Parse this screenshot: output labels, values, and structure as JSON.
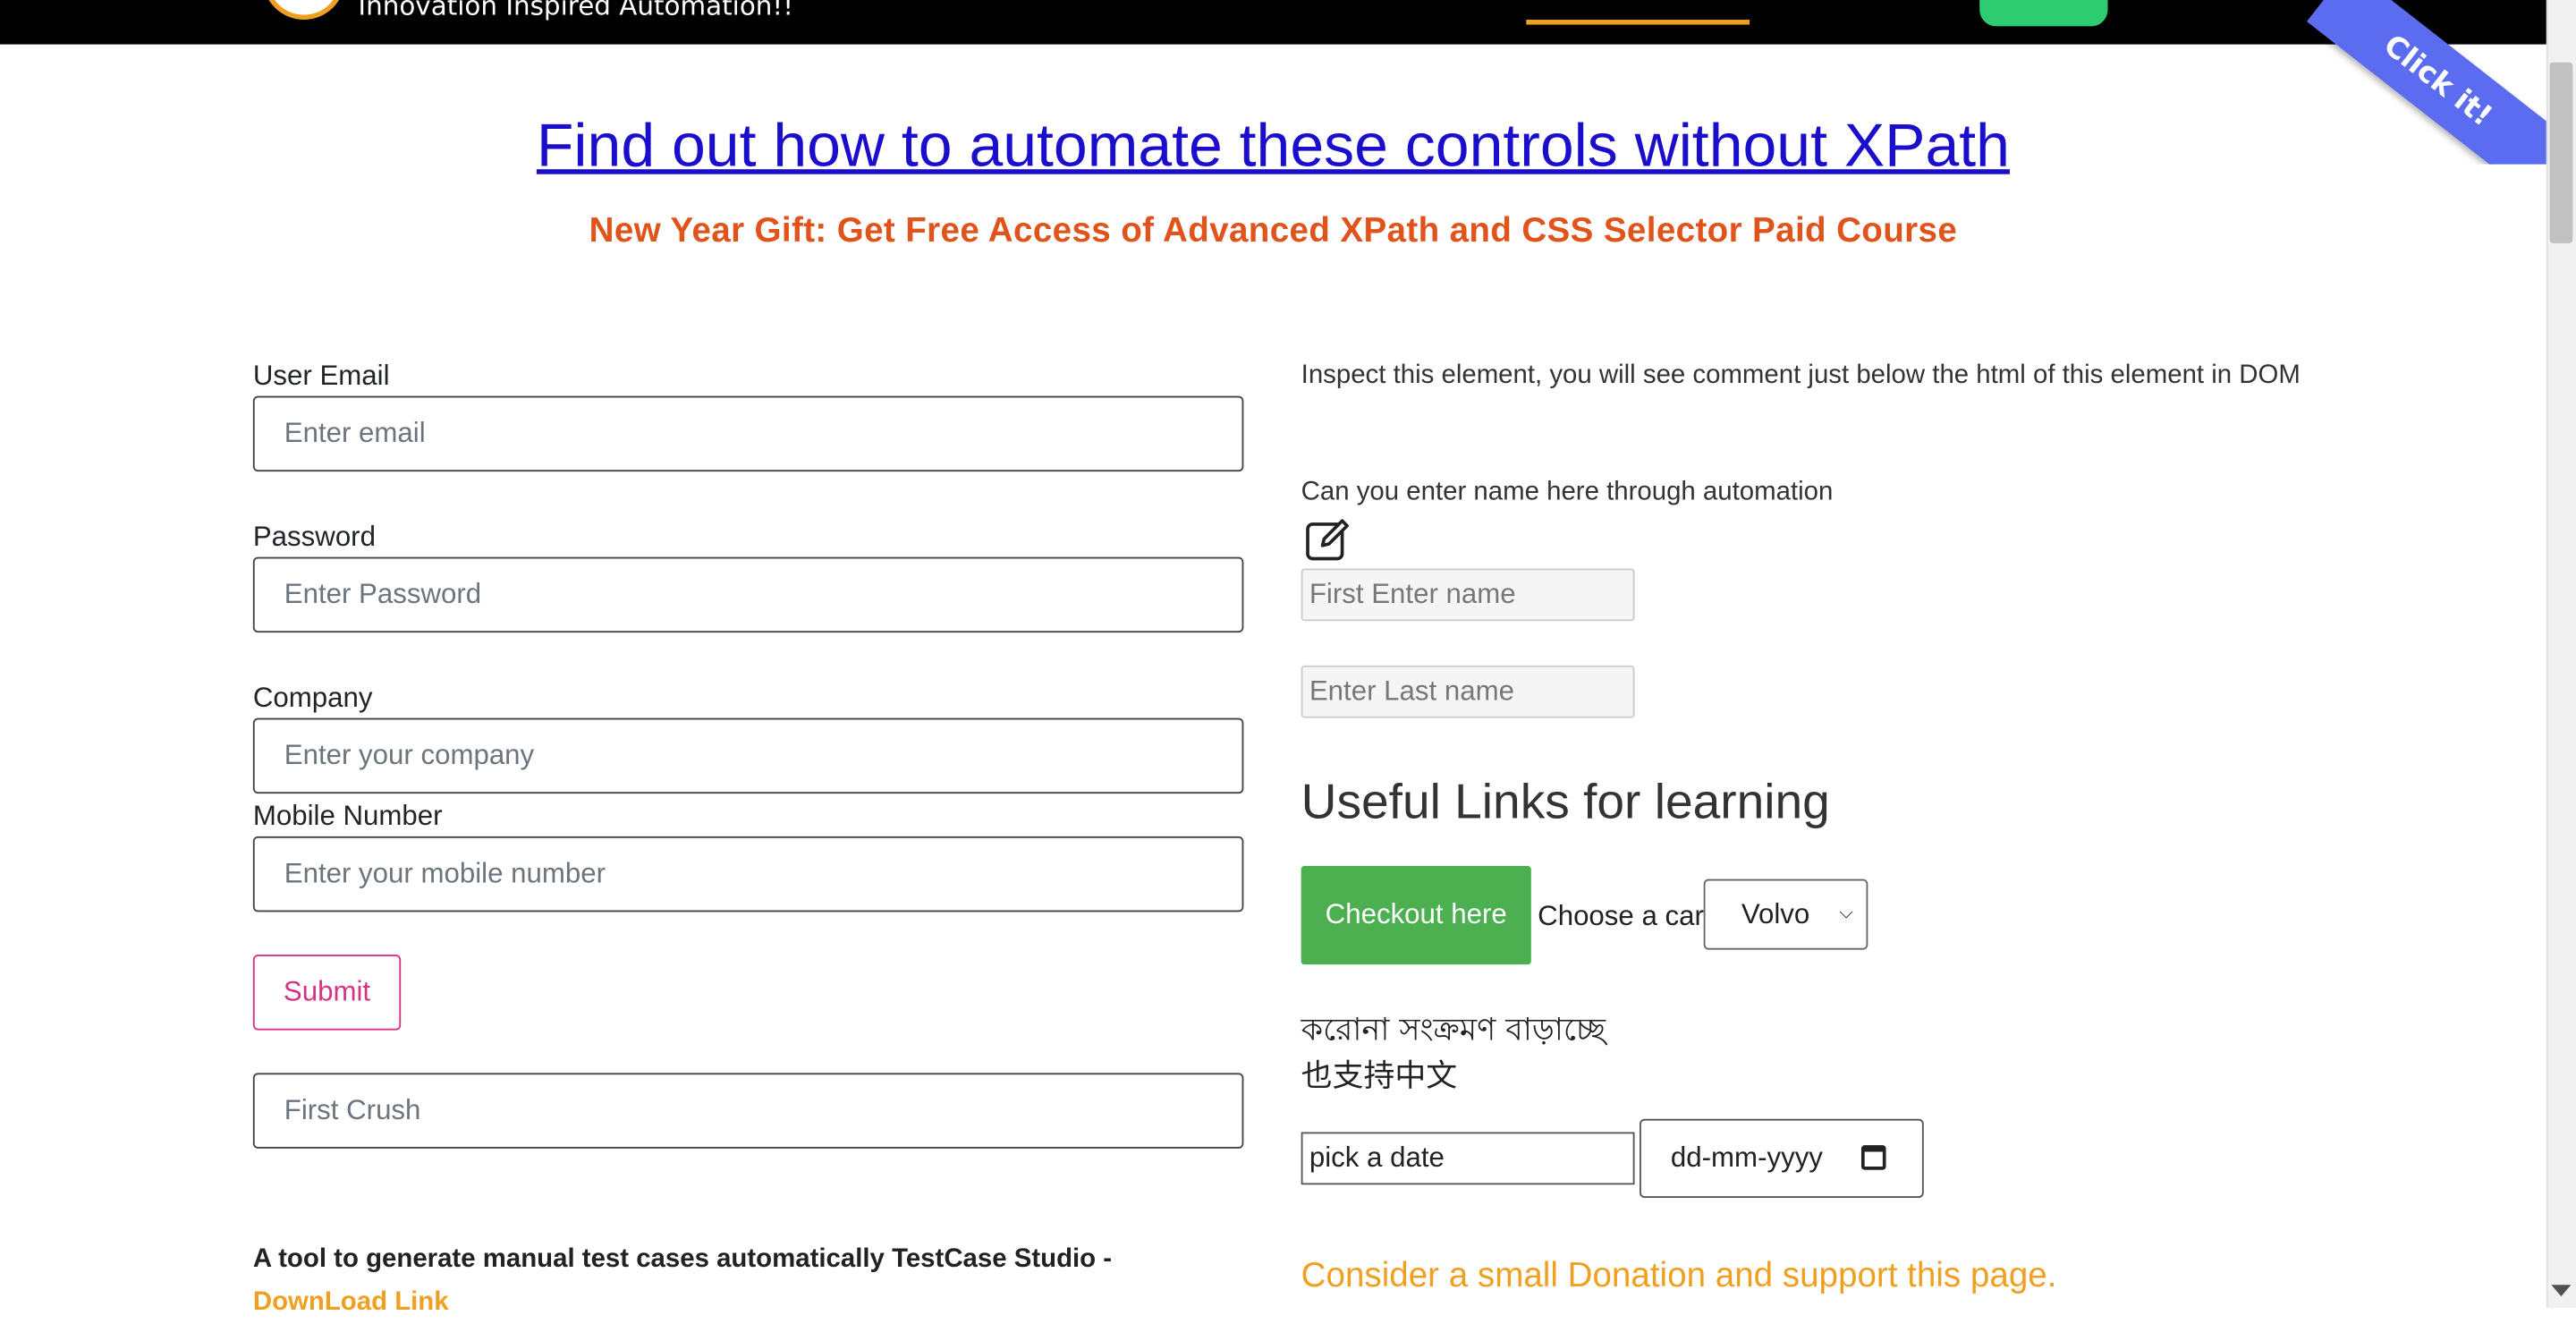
{
  "header": {
    "tagline": "Innovation Inspired Automation!!"
  },
  "ribbon": {
    "label": "Click it!"
  },
  "headline": "Find out how to automate these controls without XPath",
  "subheadline": "New Year Gift: Get Free Access of Advanced XPath and CSS Selector Paid Course",
  "form": {
    "email_label": "User Email",
    "email_placeholder": "Enter email",
    "password_label": "Password",
    "password_placeholder": "Enter Password",
    "company_label": "Company",
    "company_placeholder": "Enter your company",
    "mobile_label": "Mobile Number",
    "mobile_placeholder": "Enter your mobile number",
    "submit_label": "Submit",
    "first_crush_placeholder": "First Crush"
  },
  "tool": {
    "text": "A tool to generate manual test cases automatically TestCase Studio -",
    "link": "DownLoad Link"
  },
  "right": {
    "inspect_text": "Inspect this element, you will see comment just below the html of this element in DOM",
    "question": "Can you enter name here through automation",
    "first_name_placeholder": "First Enter name",
    "last_name_placeholder": "Enter Last name",
    "useful_heading": "Useful Links for learning",
    "checkout_label": "Checkout here",
    "car_label": "Choose a car:",
    "car_selected": "Volvo",
    "bengali_text": "করোনা সংক্রমণ বাড়াচ্ছে",
    "chinese_text": "也支持中文",
    "date_text_value": "pick a date",
    "date_picker_value": "dd-mm-yyyy",
    "donation_text": "Consider a small Donation and support this page."
  },
  "colors": {
    "link_blue": "#1a0dcc",
    "subhead_orange": "#e0531b",
    "accent_orange": "#f0a020",
    "submit_pink": "#d63384",
    "checkout_green": "#4caf50",
    "ribbon_blue": "#5b6cf0"
  }
}
